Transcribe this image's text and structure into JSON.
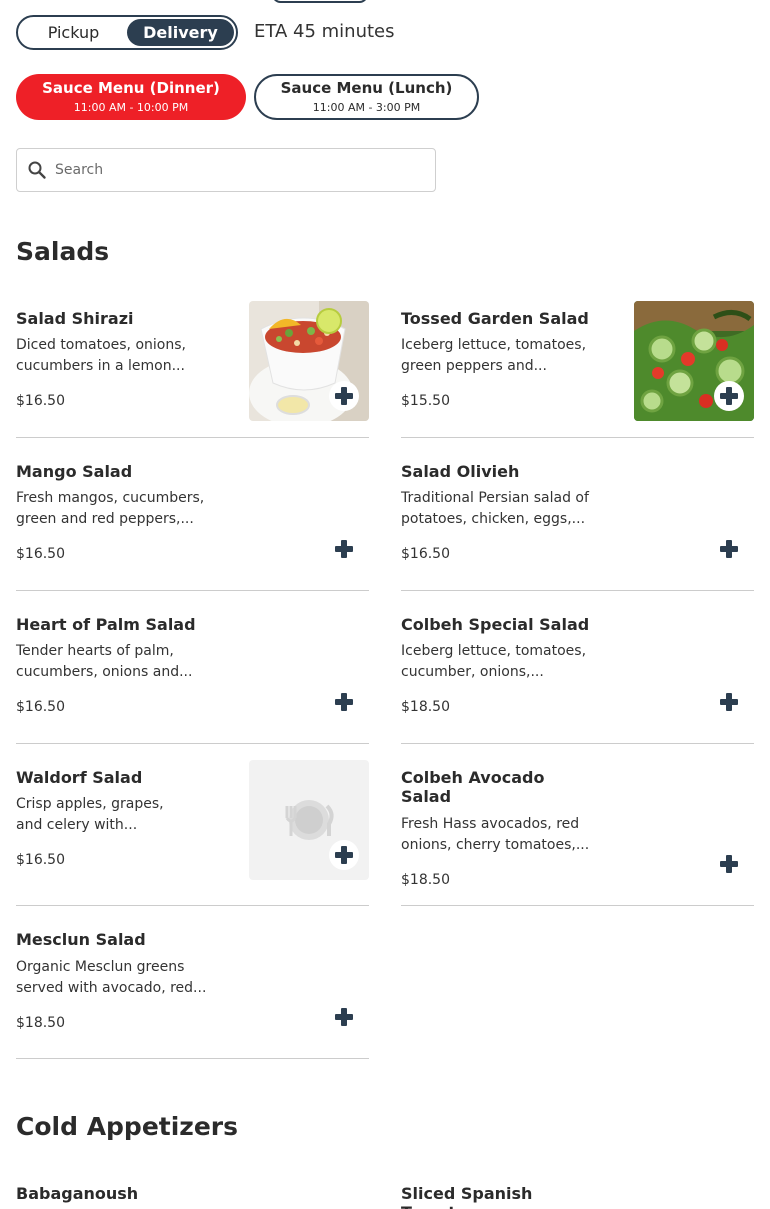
{
  "order_mode": {
    "options": [
      "Pickup",
      "Delivery"
    ],
    "selected": "Delivery",
    "eta": "ETA 45 minutes"
  },
  "menus": [
    {
      "title": "Sauce Menu (Dinner)",
      "hours": "11:00 AM - 10:00 PM",
      "active": true
    },
    {
      "title": "Sauce Menu (Lunch)",
      "hours": "11:00 AM - 3:00 PM",
      "active": false
    }
  ],
  "search": {
    "placeholder": "Search",
    "value": ""
  },
  "sections": [
    {
      "title": "Salads",
      "items": [
        {
          "name": "Salad Shirazi",
          "desc": [
            "Diced tomatoes, onions,",
            "cucumbers in a lemon..."
          ],
          "price": "$16.50",
          "image": "salad-shirazi-photo"
        },
        {
          "name": "Tossed Garden Salad",
          "desc": [
            "Iceberg lettuce, tomatoes,",
            "green peppers and..."
          ],
          "price": "$15.50",
          "image": "garden-salad-photo"
        },
        {
          "name": "Mango Salad",
          "desc": [
            "Fresh mangos, cucumbers,",
            "green and red peppers,..."
          ],
          "price": "$16.50"
        },
        {
          "name": "Salad Olivieh",
          "desc": [
            "Traditional Persian salad of",
            "potatoes, chicken, eggs,..."
          ],
          "price": "$16.50"
        },
        {
          "name": "Heart of Palm Salad",
          "desc": [
            "Tender hearts of palm,",
            "cucumbers, onions and..."
          ],
          "price": "$16.50"
        },
        {
          "name": "Colbeh Special Salad",
          "desc": [
            "Iceberg lettuce, tomatoes,",
            "cucumber, onions,..."
          ],
          "price": "$18.50"
        },
        {
          "name": "Waldorf Salad",
          "desc": [
            "Crisp apples, grapes,",
            "and celery with..."
          ],
          "price": "$16.50",
          "image": "plate-placeholder"
        },
        {
          "name": "Colbeh Avocado Salad",
          "desc": [
            "Fresh Hass avocados, red",
            "onions, cherry tomatoes,..."
          ],
          "price": "$18.50"
        },
        {
          "name": "Mesclun Salad",
          "desc": [
            "Organic Mesclun greens",
            "served with avocado, red..."
          ],
          "price": "$18.50"
        }
      ]
    },
    {
      "title": "Cold Appetizers",
      "items": [
        {
          "name": "Babaganoush"
        },
        {
          "name": "Sliced Spanish Tomatoes"
        }
      ]
    }
  ],
  "colors": {
    "brand_red": "#ee2027",
    "navy": "#2c3e50"
  },
  "icons": [
    "search-icon",
    "plus-icon",
    "plate-placeholder-icon"
  ]
}
